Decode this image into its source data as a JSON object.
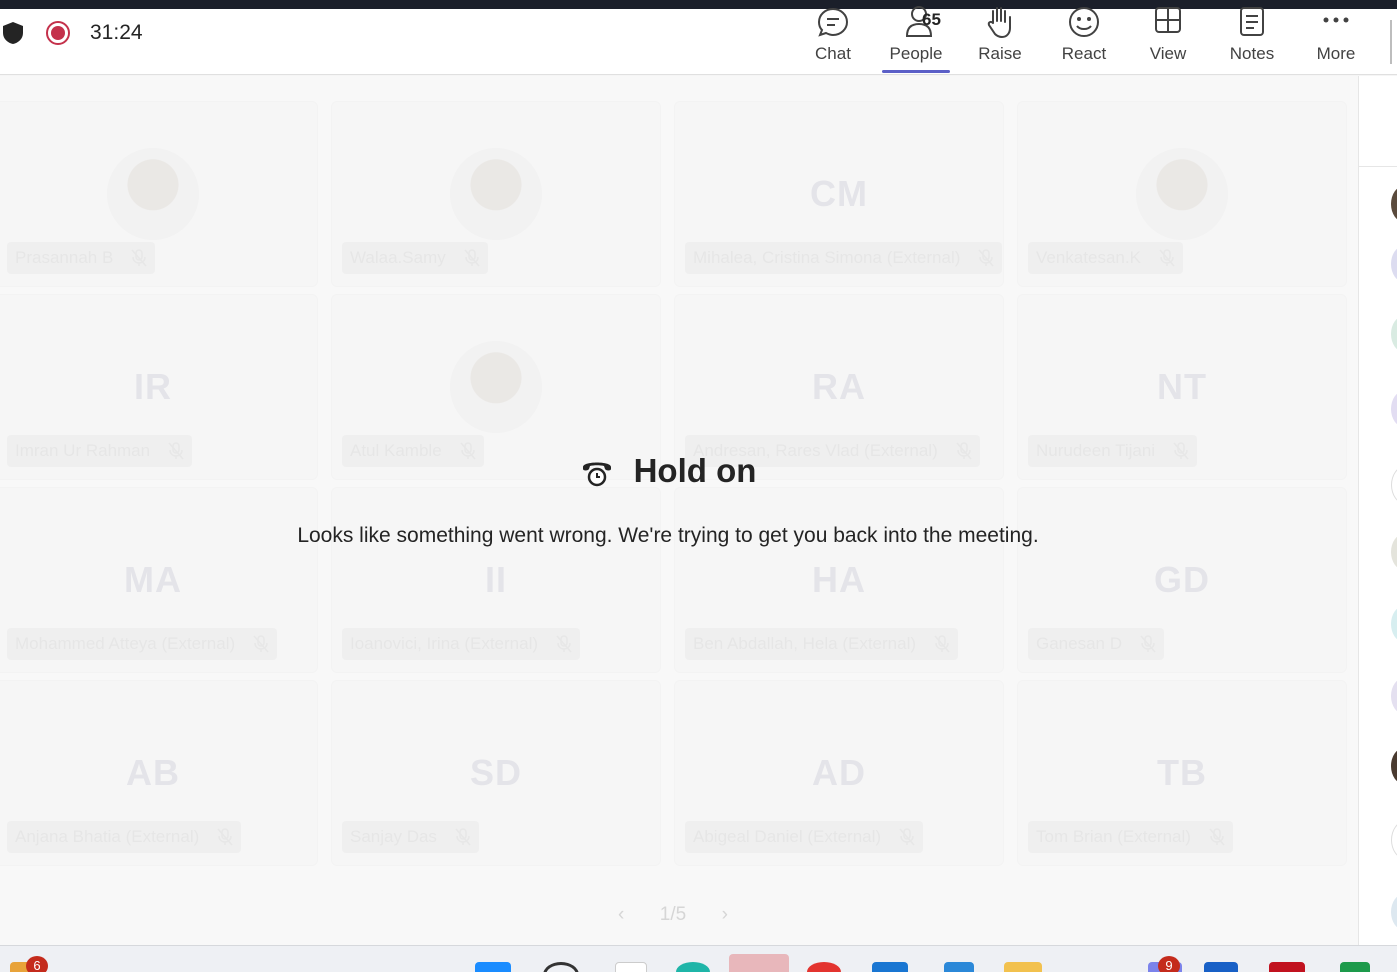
{
  "header": {
    "timer": "31:24",
    "tools": {
      "chat": {
        "label": "Chat"
      },
      "people": {
        "label": "People",
        "count": "65"
      },
      "raise": {
        "label": "Raise"
      },
      "react": {
        "label": "React"
      },
      "view": {
        "label": "View"
      },
      "notes": {
        "label": "Notes"
      },
      "more": {
        "label": "More"
      }
    }
  },
  "participants": [
    {
      "name": "Prasannah B",
      "initials": "",
      "photo": true
    },
    {
      "name": "Walaa.Samy",
      "initials": "",
      "photo": true
    },
    {
      "name": "Mihalea, Cristina Simona (External)",
      "initials": "CM",
      "photo": false
    },
    {
      "name": "Venkatesan.K",
      "initials": "",
      "photo": true
    },
    {
      "name": "Imran Ur Rahman",
      "initials": "IR",
      "photo": false
    },
    {
      "name": "Atul Kamble",
      "initials": "",
      "photo": true
    },
    {
      "name": "Andresan, Rares Vlad (External)",
      "initials": "RA",
      "photo": false
    },
    {
      "name": "Nurudeen Tijani",
      "initials": "NT",
      "photo": false
    },
    {
      "name": "Mohammed Atteya (External)",
      "initials": "MA",
      "photo": false
    },
    {
      "name": "Ioanovici, Irina (External)",
      "initials": "II",
      "photo": false
    },
    {
      "name": "Ben Abdallah, Hela (External)",
      "initials": "HA",
      "photo": false
    },
    {
      "name": "Ganesan D",
      "initials": "GD",
      "photo": false
    },
    {
      "name": "Anjana Bhatia (External)",
      "initials": "AB",
      "photo": false
    },
    {
      "name": "Sanjay Das",
      "initials": "SD",
      "photo": false
    },
    {
      "name": "Abigeal Daniel (External)",
      "initials": "AD",
      "photo": false
    },
    {
      "name": "Tom Brian (External)",
      "initials": "TB",
      "photo": false
    }
  ],
  "dialog": {
    "title": "Hold on",
    "message": "Looks like something went wrong. We're trying to get you back into the meeting."
  },
  "pager": {
    "text": "1/5"
  },
  "taskbar": {
    "badge_left": "6",
    "badge_right": "9"
  },
  "colors": {
    "accent": "#5b5fc7",
    "record": "#c4314b"
  }
}
